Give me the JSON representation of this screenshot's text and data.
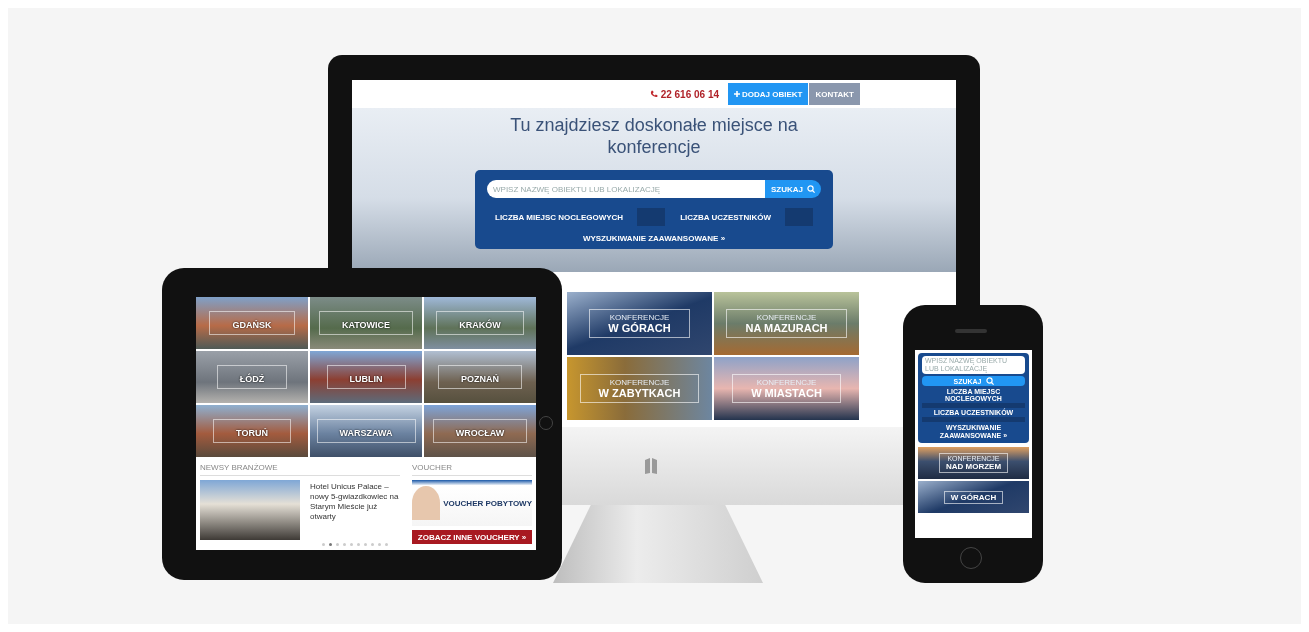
{
  "monitor": {
    "topbar": {
      "phone": "22 616 06 14",
      "buttons": [
        {
          "label": "DODAJ OBIEKT",
          "kind": "primary"
        },
        {
          "label": "KONTAKT",
          "kind": "secondary"
        }
      ]
    },
    "hero": {
      "title": "Tu znajdziesz doskonałe miejsce na konferencje",
      "search": {
        "placeholder": "WPISZ NAZWĘ OBIEKTU LUB LOKALIZACJĘ",
        "button": "SZUKAJ"
      },
      "filters": [
        {
          "label": "LICZBA MIEJSC NOCLEGOWYCH"
        },
        {
          "label": "LICZBA UCZESTNIKÓW"
        }
      ],
      "advanced_link": "WYSZUKIWANIE ZAAWANSOWANE »"
    },
    "tiles": [
      {
        "overline": "KONFERENCJE",
        "title": "W GÓRACH",
        "kind": "mountains"
      },
      {
        "overline": "KONFERENCJE",
        "title": "NA MAZURACH",
        "kind": "lake"
      },
      {
        "overline": "KONFERENCJE",
        "title": "W ZABYTKACH",
        "kind": "monument"
      },
      {
        "overline": "KONFERENCJE",
        "title": "W MIASTACH",
        "kind": "city"
      }
    ]
  },
  "tablet": {
    "cities": [
      "GDAŃSK",
      "KATOWICE",
      "KRAKÓW",
      "ŁÓDŹ",
      "LUBLIN",
      "POZNAŃ",
      "TORUŃ",
      "WARSZAWA",
      "WROCŁAW"
    ],
    "news": {
      "heading": "NEWSY BRANŻOWE",
      "title": "Hotel Unicus Palace – nowy 5-gwiazdkowiec na Starym Mieście już otwarty",
      "dots": [
        {
          "selected": false
        },
        {
          "selected": true
        },
        {
          "selected": false
        },
        {
          "selected": false
        },
        {
          "selected": false
        },
        {
          "selected": false
        },
        {
          "selected": false
        },
        {
          "selected": false
        },
        {
          "selected": false
        },
        {
          "selected": false
        }
      ]
    },
    "voucher": {
      "heading": "VOUCHER",
      "banner": "VOUCHER POBYTOWY",
      "button": "ZOBACZ INNE VOUCHERY »"
    }
  },
  "phone": {
    "search": {
      "placeholder": "WPISZ NAZWĘ OBIEKTU LUB LOKALIZACJĘ",
      "button": "SZUKAJ"
    },
    "filters": [
      {
        "label": "LICZBA MIEJSC NOCLEGOWYCH"
      },
      {
        "label": "LICZBA UCZESTNIKÓW"
      }
    ],
    "advanced_link": "WYSZUKIWANIE ZAAWANSOWANE »",
    "tiles": [
      {
        "overline": "KONFERENCJE",
        "title": "NAD MORZEM",
        "kind": "sea"
      },
      {
        "title": "W GÓRACH",
        "kind": "mountains"
      }
    ]
  }
}
